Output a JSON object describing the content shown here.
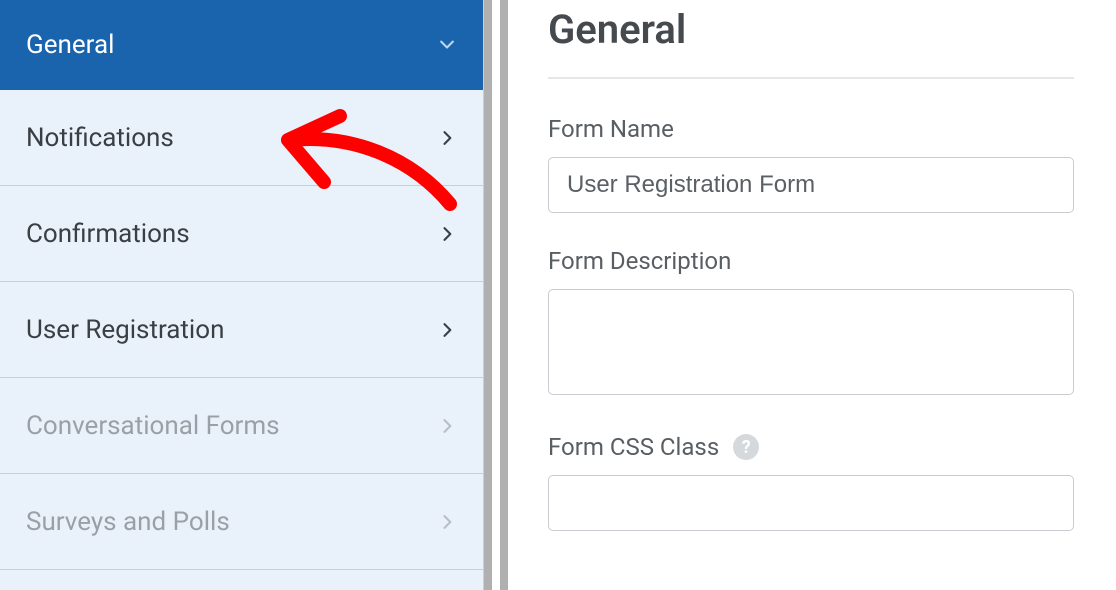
{
  "sidebar": {
    "items": [
      {
        "label": "General",
        "active": true,
        "chevron": "down"
      },
      {
        "label": "Notifications"
      },
      {
        "label": "Confirmations"
      },
      {
        "label": "User Registration"
      },
      {
        "label": "Conversational Forms",
        "muted": true
      },
      {
        "label": "Surveys and Polls",
        "muted": true
      }
    ]
  },
  "main": {
    "title": "General",
    "form_name_label": "Form Name",
    "form_name_value": "User Registration Form",
    "form_description_label": "Form Description",
    "form_description_value": "",
    "form_css_class_label": "Form CSS Class",
    "form_css_class_value": ""
  },
  "annotation": {
    "color": "#ff0000"
  }
}
